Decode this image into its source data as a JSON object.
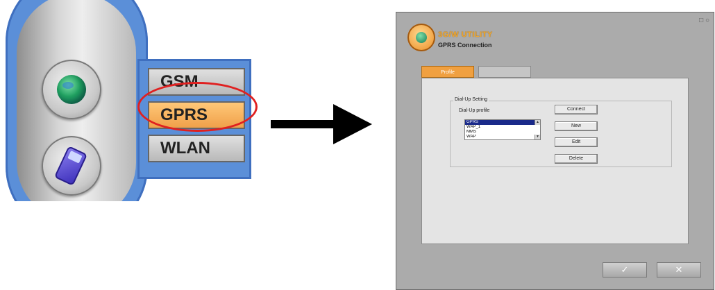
{
  "launcher": {
    "menu": [
      {
        "label": "GSM",
        "selected": false
      },
      {
        "label": "GPRS",
        "selected": true
      },
      {
        "label": "WLAN",
        "selected": false
      }
    ],
    "colors": {
      "panel_blue": "#5b8fd8",
      "selected": "#f0a04a",
      "highlight_ring": "#e02020"
    }
  },
  "window": {
    "title": "3G/W UTILITY",
    "subtitle": "GPRS Connection",
    "tabs": [
      {
        "label": "Profile",
        "active": true
      },
      {
        "label": "",
        "active": false
      }
    ],
    "group": {
      "title": "Dial-Up Setting",
      "list_label": "Dial-Up profile",
      "profiles": [
        "GPRS",
        "WAP_1",
        "MMS",
        "WAP"
      ]
    },
    "buttons": {
      "connect": "Connect",
      "new": "New",
      "edit": "Edit",
      "delete": "Delete"
    },
    "footer": {
      "ok": "✓",
      "cancel": "✕"
    },
    "win_controls": "□ ○"
  }
}
